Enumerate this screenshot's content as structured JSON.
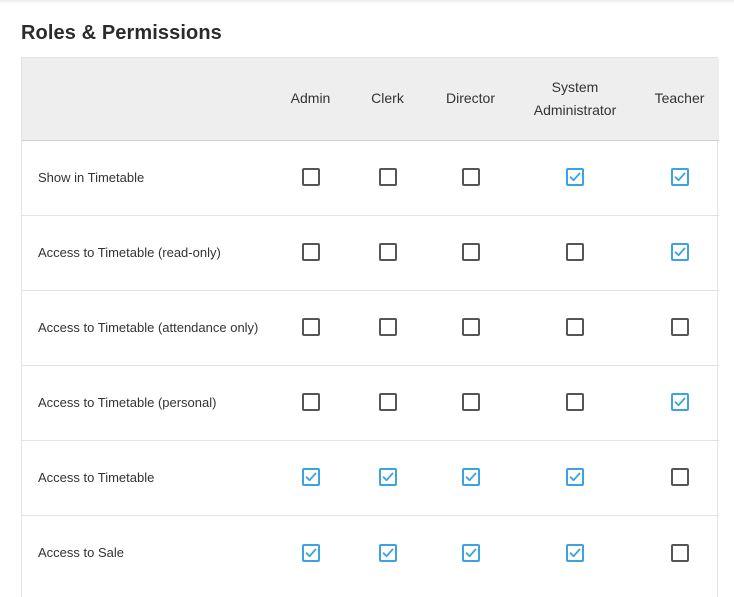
{
  "page": {
    "title": "Roles & Permissions"
  },
  "table": {
    "columns": [
      "Admin",
      "Clerk",
      "Director",
      "System Administrator",
      "Teacher"
    ],
    "rows": [
      {
        "label": "Show in Timetable",
        "checked": [
          false,
          false,
          false,
          true,
          true
        ]
      },
      {
        "label": "Access to Timetable (read-only)",
        "checked": [
          false,
          false,
          false,
          false,
          true
        ]
      },
      {
        "label": "Access to Timetable (attendance only)",
        "checked": [
          false,
          false,
          false,
          false,
          false
        ]
      },
      {
        "label": "Access to Timetable (personal)",
        "checked": [
          false,
          false,
          false,
          false,
          true
        ]
      },
      {
        "label": "Access to Timetable",
        "checked": [
          true,
          true,
          true,
          true,
          false
        ]
      },
      {
        "label": "Access to Sale",
        "checked": [
          true,
          true,
          true,
          true,
          false
        ]
      }
    ]
  },
  "colors": {
    "checked_accent": "#3da2e0",
    "unchecked_border": "#555555",
    "header_background": "#eeeeee"
  },
  "icons": {
    "checked": "checkmark-icon"
  }
}
